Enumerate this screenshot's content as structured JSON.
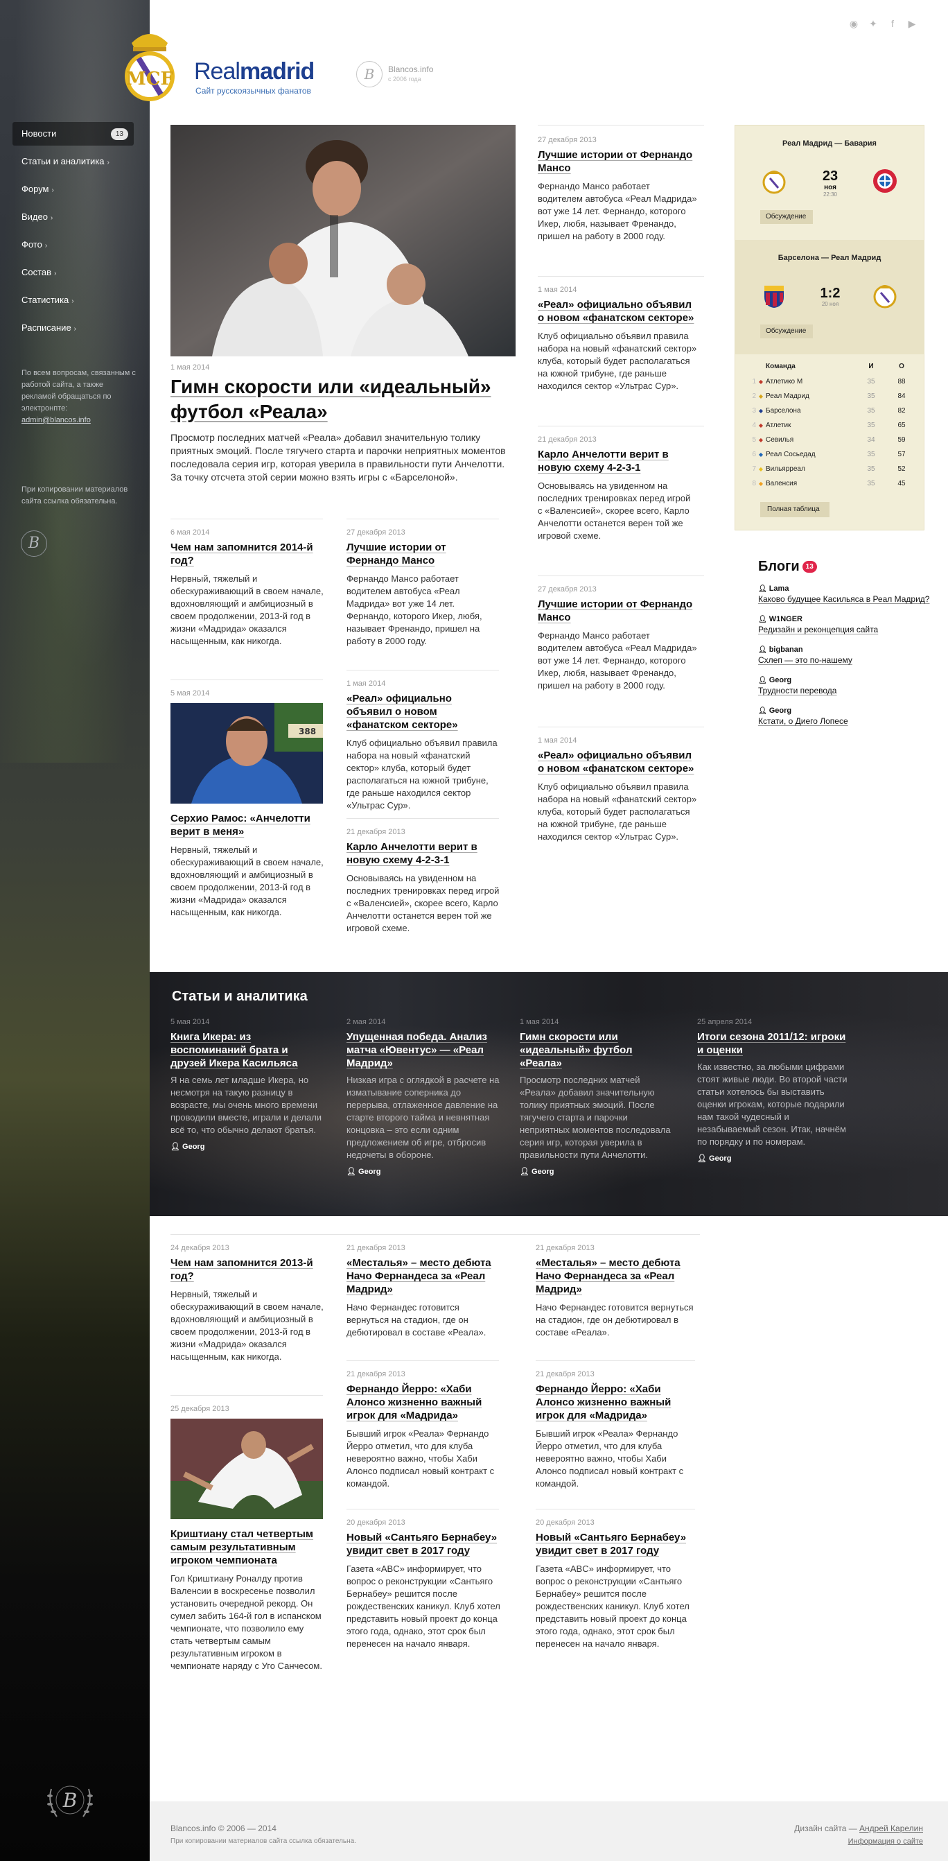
{
  "header": {
    "brand_light": "Real",
    "brand_bold": "madrid",
    "brand_sub": "Сайт русскоязычных фанатов",
    "partner_name": "Blancos.info",
    "partner_sub": "с 2006 года",
    "socials": [
      "rss-icon",
      "twitter-icon",
      "facebook-icon",
      "youtube-icon"
    ]
  },
  "sidebar": {
    "items": [
      {
        "label": "Новости",
        "badge": "13"
      },
      {
        "label": "Статьи и аналитика"
      },
      {
        "label": "Форум"
      },
      {
        "label": "Видео"
      },
      {
        "label": "Фото"
      },
      {
        "label": "Состав"
      },
      {
        "label": "Статистика"
      },
      {
        "label": "Расписание"
      }
    ],
    "contact_text": "По всем вопросам, связанным с работой сайта, а также рекламой обращаться по электронпте:",
    "contact_email": "admin@blancos.info",
    "copy_note": "При копировании материалов сайта ссылка обязательна."
  },
  "hero": {
    "date": "1 мая 2014",
    "title": "Гимн скорости или «идеальный» футбол «Реала»",
    "excerpt": "Просмотр последних матчей «Реала» добавил значительную толику приятных эмоций. После тягучего старта и парочки неприятных моментов последовала серия игр, которая уверила в правильности пути Анчелотти. За точку отсчета этой серии можно взять игры с «Барселоной»."
  },
  "col_mid_left": [
    {
      "date": "6 мая 2014",
      "title": "Чем нам запомнится 2014-й год?",
      "excerpt": "Нервный, тяжелый и обескураживающий в своем начале, вдохновляющий и амбициозный в своем продолжении, 2013-й год в жизни «Мадрида» оказался насыщенным, как никогда."
    },
    {
      "date": "5 мая 2014",
      "title": "Серхио Рамос: «Анчелотти верит в меня»",
      "excerpt": "Нервный, тяжелый и обескураживающий в своем начале, вдохновляющий и амбициозный в своем продолжении, 2013-й год в жизни «Мадрида» оказался насыщенным, как никогда."
    }
  ],
  "col_mid_right": [
    {
      "date": "27 декабря 2013",
      "title": "Лучшие истории от Фернандо Мансо",
      "excerpt": "Фернандо Мансо работает водителем автобуса «Реал Мадрида» вот уже 14 лет. Фернандо, которого Икер, любя, называет Френандо, пришел на работу в 2000 году."
    },
    {
      "date": "1 мая 2014",
      "title": "«Реал» официально объявил о новом «фанатском секторе»",
      "excerpt": "Клуб официально объявил правила набора на новый «фанатский сектор» клуба, который будет располагаться на южной трибуне, где раньше находился сектор «Ультрас Сур»."
    },
    {
      "date": "21 декабря 2013",
      "title": "Карло Анчелотти верит в новую схему 4-2-3-1",
      "excerpt": "Основываясь на увиденном на последних тренировках перед игрой с «Валенсией», скорее всего, Карло Анчелотти останется верен той же игровой схеме."
    }
  ],
  "col_right": [
    {
      "date": "27 декабря 2013",
      "title": "Лучшие истории от Фернандо Мансо",
      "excerpt": "Фернандо Мансо работает водителем автобуса «Реал Мадрида» вот уже 14 лет. Фернандо, которого Икер, любя, называет Френандо, пришел на работу в 2000 году."
    },
    {
      "date": "1 мая 2014",
      "title": "«Реал» официально объявил о новом «фанатском секторе»",
      "excerpt": "Клуб официально объявил правила набора на новый «фанатский сектор» клуба, который будет располагаться на южной трибуне, где раньше находился сектор «Ультрас Сур»."
    },
    {
      "date": "21 декабря 2013",
      "title": "Карло Анчелотти верит в новую схему 4-2-3-1",
      "excerpt": "Основываясь на увиденном на последних тренировках перед игрой с «Валенсией», скорее всего, Карло Анчелотти останется верен той же игровой схеме."
    },
    {
      "date": "27 декабря 2013",
      "title": "Лучшие истории от Фернандо Мансо",
      "excerpt": "Фернандо Мансо работает водителем автобуса «Реал Мадрида» вот уже 14 лет. Фернандо, которого Икер, любя, называет Френандо, пришел на работу в 2000 году."
    },
    {
      "date": "1 мая 2014",
      "title": "«Реал» официально объявил о новом «фанатском секторе»",
      "excerpt": "Клуб официально объявил правила набора на новый «фанатский сектор» клуба, который будет располагаться на южной трибуне, где раньше находился сектор «Ультрас Сур»."
    }
  ],
  "matches": [
    {
      "title": "Реал Мадрид — Бавария",
      "big": "23",
      "small": "ноя",
      "tiny": "22:30",
      "button": "Обсуждение"
    },
    {
      "title": "Барселона — Реал Мадрид",
      "big": "1:2",
      "small": "",
      "tiny": "20 ноя",
      "button": "Обсуждение"
    }
  ],
  "standings": {
    "headers": [
      "Команда",
      "И",
      "О"
    ],
    "rows": [
      {
        "n": "1",
        "team": "Атлетико М",
        "g": "35",
        "p": "88"
      },
      {
        "n": "2",
        "team": "Реал Мадрид",
        "g": "35",
        "p": "84"
      },
      {
        "n": "3",
        "team": "Барселона",
        "g": "35",
        "p": "82"
      },
      {
        "n": "4",
        "team": "Атлетик",
        "g": "35",
        "p": "65"
      },
      {
        "n": "5",
        "team": "Севилья",
        "g": "34",
        "p": "59"
      },
      {
        "n": "6",
        "team": "Реал Сосьедад",
        "g": "35",
        "p": "57"
      },
      {
        "n": "7",
        "team": "Вильярреал",
        "g": "35",
        "p": "52"
      },
      {
        "n": "8",
        "team": "Валенсия",
        "g": "35",
        "p": "45"
      }
    ],
    "button": "Полная таблица"
  },
  "blogs": {
    "title": "Блоги",
    "badge": "13",
    "items": [
      {
        "author": "Lama",
        "link": "Каково будущее Касильяса в Реал Мадрид?"
      },
      {
        "author": "W1NGER",
        "link": "Редизайн и реконцепция сайта"
      },
      {
        "author": "bigbanan",
        "link": "Схлеп — это по-нашему"
      },
      {
        "author": "Georg",
        "link": "Трудности перевода"
      },
      {
        "author": "Georg",
        "link": "Кстати, о Диего Лопесе"
      }
    ]
  },
  "band": {
    "title": "Статьи и аналитика",
    "items": [
      {
        "date": "5 мая 2014",
        "title": "Книга Икера: из воспоминаний брата и друзей Икера Касильяса",
        "excerpt": "Я на семь лет младше Икера, но несмотря на такую разницу в возрасте, мы очень много времени проводили вместе, играли и делали всё то, что обычно делают братья.",
        "author": "Georg"
      },
      {
        "date": "2 мая 2014",
        "title": "Упущенная победа. Анализ матча «Ювентус» — «Реал Мадрид»",
        "excerpt": "Низкая игра с оглядкой в расчете на изматывание соперника до перерыва, отлаженное давление на старте второго тайма и невнятная концовка – это если одним предложением об игре, отбросив недочеты в обороне.",
        "author": "Georg"
      },
      {
        "date": "1 мая 2014",
        "title": "Гимн скорости или «идеальный» футбол «Реала»",
        "excerpt": "Просмотр последних матчей «Реала» добавил значительную толику приятных эмоций. После тягучего старта и парочки неприятных моментов последовала серия игр, которая уверила в правильности пути Анчелотти.",
        "author": "Georg"
      },
      {
        "date": "25 апреля 2014",
        "title": "Итоги сезона 2011/12: игроки и оценки",
        "excerpt": "Как известно, за любыми цифрами стоят живые люди. Во второй части статьи хотелось бы выставить оценки игрокам, которые подарили нам такой чудесный и незабываемый сезон. Итак, начнём по порядку и по номерам.",
        "author": "Georg"
      }
    ]
  },
  "lower_col1": [
    {
      "date": "24 декабря 2013",
      "title": "Чем нам запомнится 2013-й год?",
      "excerpt": "Нервный, тяжелый и обескураживающий в своем начале, вдохновляющий и амбициозный в своем продолжении, 2013-й год в жизни «Мадрида» оказался насыщенным, как никогда."
    },
    {
      "date": "25 декабря 2013",
      "title": "Криштиану стал четвертым самым результативным игроком чемпионата",
      "excerpt": "Гол Криштиану Роналду против Валенсии в воскресенье позволил установить очередной рекорд. Он сумел забить 164-й гол в испанском чемпионате, что позволило ему стать четвертым самым результативным игроком в чемпионате наряду с Уго Санчесом."
    }
  ],
  "lower_col2": [
    {
      "date": "21 декабря 2013",
      "title": "«Месталья» – место дебюта Начо Фернандеса за «Реал Мадрид»",
      "excerpt": "Начо Фернандес готовится вернуться на стадион, где он дебютировал в составе «Реала»."
    },
    {
      "date": "21 декабря 2013",
      "title": "Фернандо Йерро: «Хаби Алонсо жизненно важный игрок для «Мадрида»",
      "excerpt": "Бывший игрок «Реала» Фернандо Йерро отметил, что для клуба невероятно важно, чтобы Хаби Алонсо подписал новый контракт с командой."
    },
    {
      "date": "20 декабря 2013",
      "title": "Новый «Сантьяго Бернабеу» увидит свет в 2017 году",
      "excerpt": "Газета «ABC» информирует, что вопрос о реконструкции «Сантьяго Бернабеу» решится после рождественских каникул. Клуб хотел представить новый проект до конца этого года, однако, этот срок был перенесен на начало января."
    }
  ],
  "lower_col3": [
    {
      "date": "21 декабря 2013",
      "title": "«Месталья» – место дебюта Начо Фернандеса за «Реал Мадрид»",
      "excerpt": "Начо Фернандес готовится вернуться на стадион, где он дебютировал в составе «Реала»."
    },
    {
      "date": "21 декабря 2013",
      "title": "Фернандо Йерро: «Хаби Алонсо жизненно важный игрок для «Мадрида»",
      "excerpt": "Бывший игрок «Реала» Фернандо Йерро отметил, что для клуба невероятно важно, чтобы Хаби Алонсо подписал новый контракт с командой."
    },
    {
      "date": "20 декабря 2013",
      "title": "Новый «Сантьяго Бернабеу» увидит свет в 2017 году",
      "excerpt": "Газета «ABC» информирует, что вопрос о реконструкции «Сантьяго Бернабеу» решится после рождественских каникул. Клуб хотел представить новый проект до конца этого года, однако, этот срок был перенесен на начало января."
    }
  ],
  "footer": {
    "copyright": "Blancos.info © 2006 — 2014",
    "note": "При копировании материалов сайта ссылка обязательна.",
    "design_prefix": "Дизайн сайта — ",
    "designer": "Андрей Карелин",
    "info_link": "Информация о сайте"
  }
}
